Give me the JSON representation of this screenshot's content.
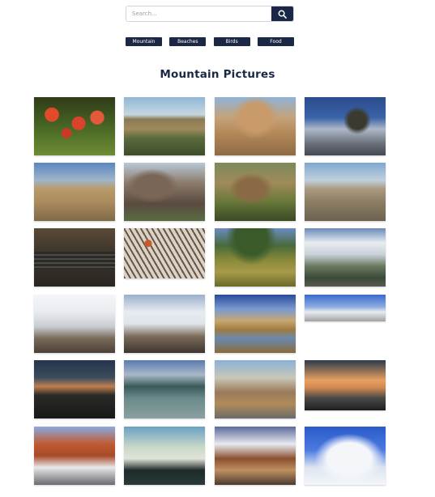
{
  "search": {
    "placeholder": "Search...",
    "icon": "search-icon"
  },
  "categories": [
    "Mountain",
    "Beaches",
    "Birds",
    "Food"
  ],
  "title": "Mountain Pictures",
  "colors": {
    "accent": "#1a2845",
    "background": "#ffffff"
  }
}
